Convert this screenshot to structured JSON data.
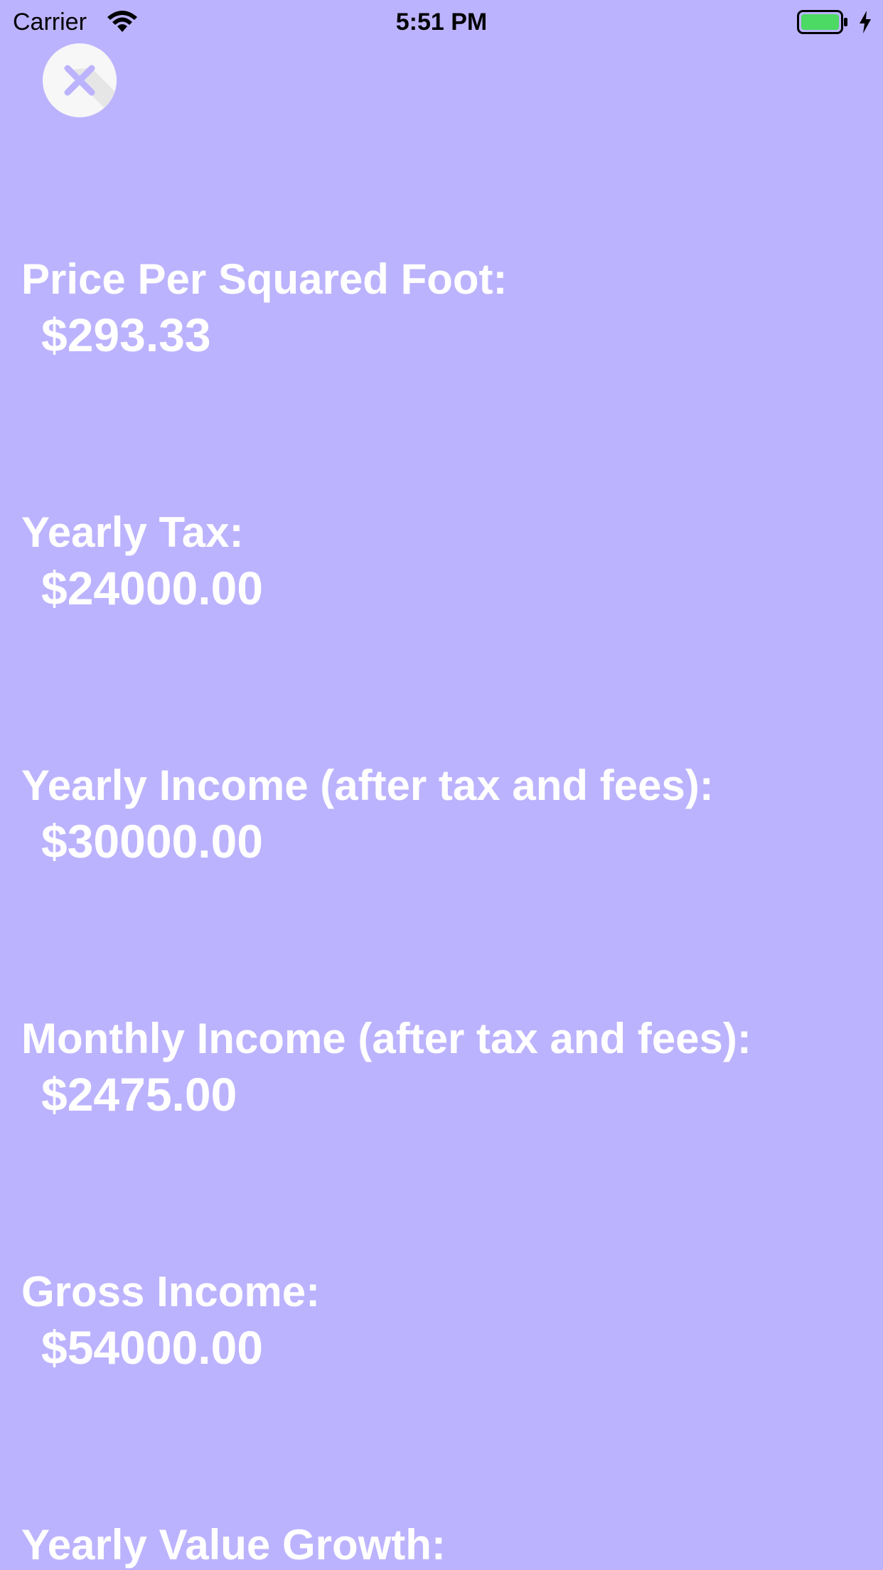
{
  "status_bar": {
    "carrier": "Carrier",
    "time": "5:51 PM",
    "battery_color": "#4cd964",
    "icons": [
      "wifi-icon",
      "battery-icon",
      "charging-bolt-icon"
    ]
  },
  "close_button": {
    "icon": "close-icon",
    "background": "#f7f7f7",
    "icon_color": "#bcb3fe"
  },
  "background_color": "#bcb3fe",
  "stats": [
    {
      "label": "Price Per Squared Foot:",
      "value": "$293.33"
    },
    {
      "label": "Yearly Tax:",
      "value": "$24000.00"
    },
    {
      "label": "Yearly Income (after tax and fees):",
      "value": "$30000.00"
    },
    {
      "label": "Monthly Income (after tax and fees):",
      "value": "$2475.00"
    },
    {
      "label": "Gross Income:",
      "value": "$54000.00"
    },
    {
      "label": "Yearly Value Growth:",
      "value": ""
    }
  ]
}
